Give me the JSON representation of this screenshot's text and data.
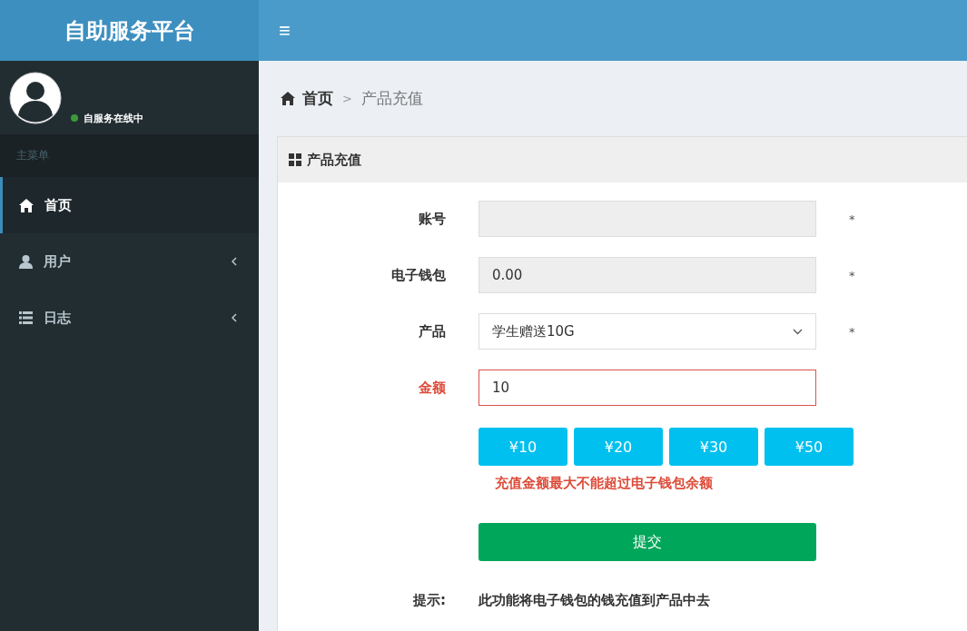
{
  "header": {
    "title": "自助服务平台",
    "menu_icon": "≡"
  },
  "user_panel": {
    "status": "自服务在线中",
    "online": true
  },
  "sidebar": {
    "heading": "主菜单",
    "items": [
      {
        "label": "首页",
        "selected": true,
        "has_children": false
      },
      {
        "label": "用户",
        "selected": false,
        "has_children": true
      },
      {
        "label": "日志",
        "selected": false,
        "has_children": true
      }
    ]
  },
  "breadcrumb": {
    "items": [
      "首页",
      "产品充值"
    ],
    "separator": ">"
  },
  "card": {
    "title": "产品充值",
    "fields": [
      {
        "label": "账号",
        "kind": "readonly",
        "required_mark": "*",
        "error": false
      },
      {
        "label": "电子钱包",
        "kind": "readonly",
        "value": "0.00",
        "required_mark": "*",
        "error": false
      },
      {
        "label": "产品",
        "kind": "select",
        "value": "学生赠送10G",
        "required_mark": "*",
        "error": false
      },
      {
        "label": "金额",
        "kind": "input",
        "value": "10",
        "error": true
      }
    ],
    "amount_buttons": [
      "¥10",
      "¥20",
      "¥30",
      "¥50"
    ],
    "warning": "充值金额最大不能超过电子钱包余额",
    "submit": "提交",
    "hint_label": "提示:",
    "hint": "此功能将电子钱包的钱充值到产品中去"
  }
}
